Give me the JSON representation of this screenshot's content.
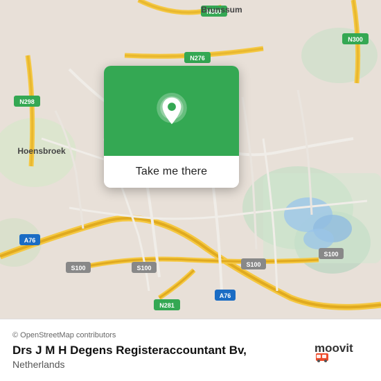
{
  "map": {
    "background_color": "#e8e0d8"
  },
  "popup": {
    "button_label": "Take me there",
    "pin_color": "#ffffff",
    "bg_color": "#34a853"
  },
  "bottom_bar": {
    "copyright_text": "© OpenStreetMap contributors",
    "place_name": "Drs J M H Degens Registeraccountant Bv,",
    "place_country": "Netherlands",
    "logo_text": "moovit"
  }
}
